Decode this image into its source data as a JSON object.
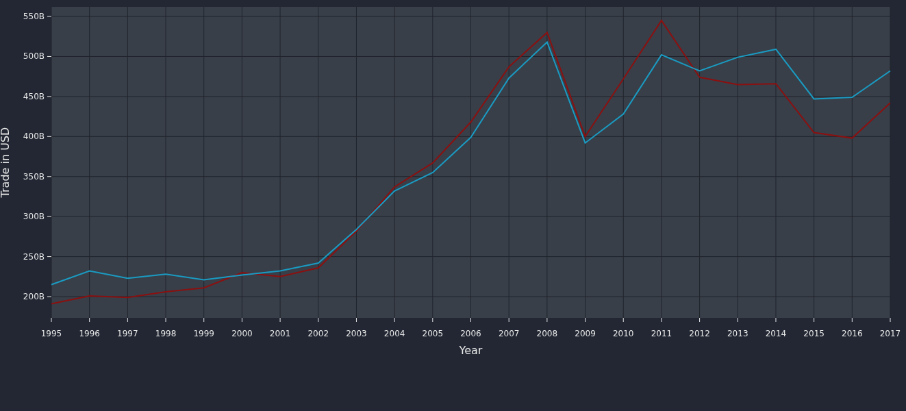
{
  "chart_data": {
    "type": "line",
    "xlabel": "Year",
    "ylabel": "Trade in USD",
    "grid": true,
    "x": [
      1995,
      1996,
      1997,
      1998,
      1999,
      2000,
      2001,
      2002,
      2003,
      2004,
      2005,
      2006,
      2007,
      2008,
      2009,
      2010,
      2011,
      2012,
      2013,
      2014,
      2015,
      2016,
      2017
    ],
    "xlim": [
      1995,
      2017
    ],
    "ylim": [
      173.5,
      562
    ],
    "xticks": [
      1995,
      1996,
      1997,
      1998,
      1999,
      2000,
      2001,
      2002,
      2003,
      2004,
      2005,
      2006,
      2007,
      2008,
      2009,
      2010,
      2011,
      2012,
      2013,
      2014,
      2015,
      2016,
      2017
    ],
    "yticks": [
      {
        "value": 200,
        "label": "200B"
      },
      {
        "value": 250,
        "label": "250B"
      },
      {
        "value": 300,
        "label": "300B"
      },
      {
        "value": 350,
        "label": "350B"
      },
      {
        "value": 400,
        "label": "400B"
      },
      {
        "value": 450,
        "label": "450B"
      },
      {
        "value": 500,
        "label": "500B"
      },
      {
        "value": 550,
        "label": "550B"
      }
    ],
    "series": [
      {
        "color": "#8b1010",
        "values": [
          191,
          201,
          199,
          206,
          211,
          230,
          225,
          236,
          282,
          337,
          367,
          418,
          487,
          530,
          400,
          472,
          545,
          474,
          465,
          466,
          405,
          398,
          442
        ]
      },
      {
        "color": "#1a9bc2",
        "values": [
          215,
          232,
          223,
          228,
          221,
          227,
          232,
          242,
          284,
          332,
          355,
          399,
          473,
          518,
          392,
          428,
          502,
          482,
          499,
          509,
          447,
          449,
          482
        ]
      }
    ]
  }
}
